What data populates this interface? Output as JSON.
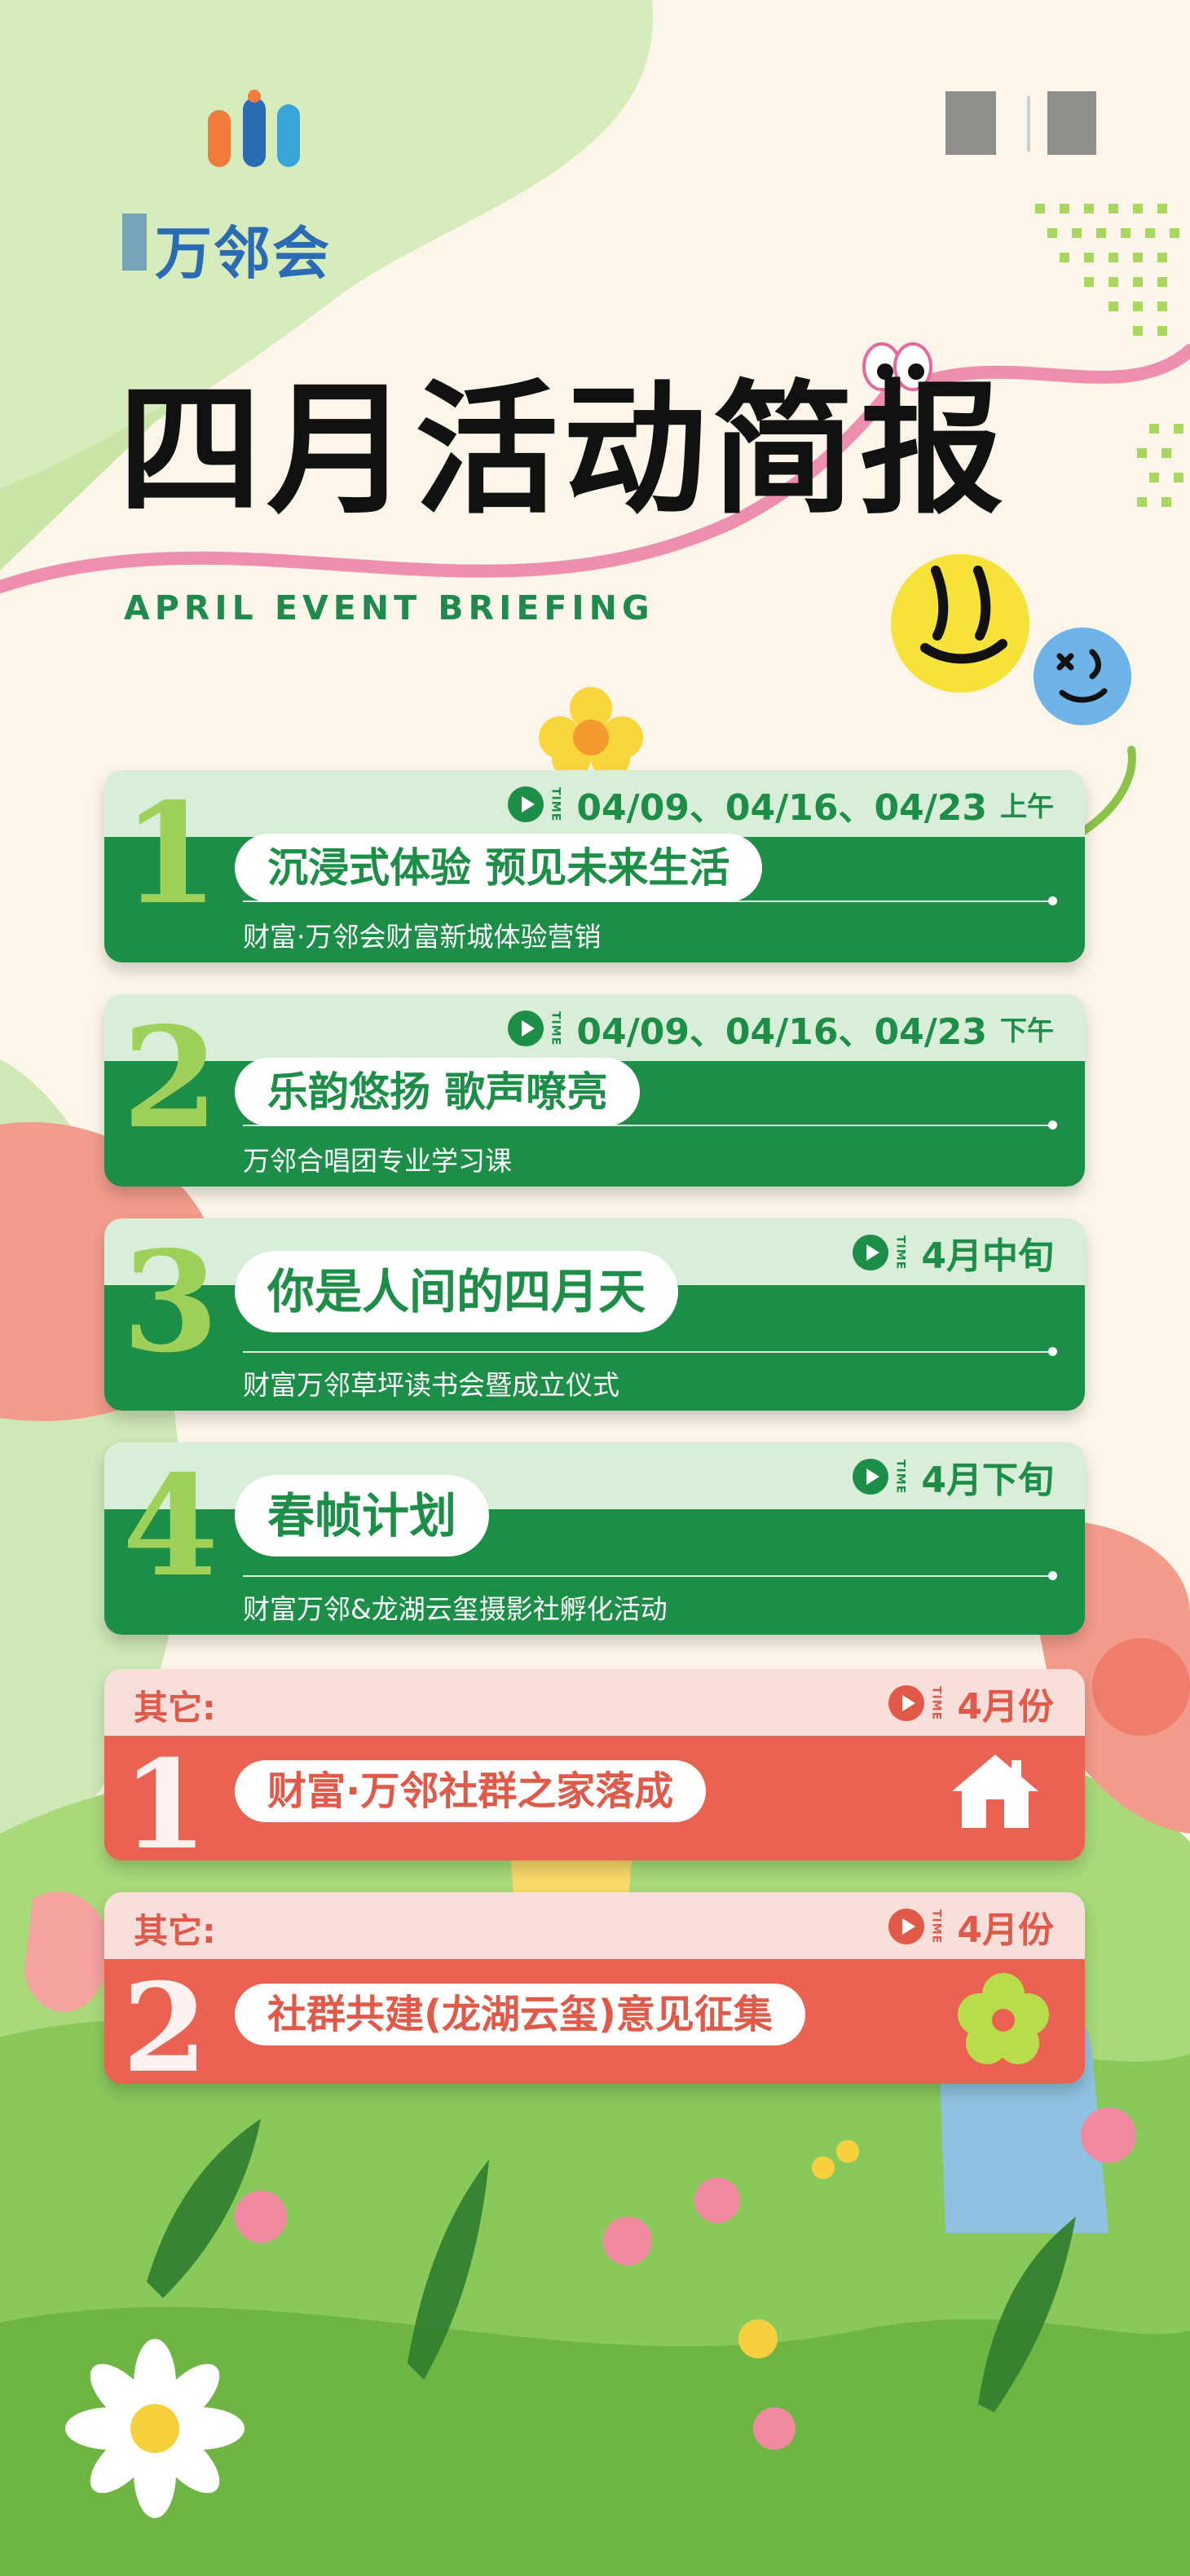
{
  "brand": {
    "logo_text": "万邻会",
    "colors": {
      "green": "#1d8e47",
      "light_green": "#d9eed9",
      "accent_lime": "#9ed05a",
      "red": "#ea6251",
      "light_red": "#f8dfdb",
      "cream": "#fbf6e9"
    }
  },
  "header": {
    "title": "四月活动简报",
    "subtitle": "APRIL EVENT BRIEFING"
  },
  "time_tag": "TIME",
  "events": [
    {
      "number": "1",
      "time": "04/09、04/16、04/23",
      "period": "上午",
      "title": "沉浸式体验 预见未来生活",
      "description": "财富·万邻会财富新城体验营销"
    },
    {
      "number": "2",
      "time": "04/09、04/16、04/23",
      "period": "下午",
      "title": "乐韵悠扬 歌声嘹亮",
      "description": "万邻合唱团专业学习课"
    },
    {
      "number": "3",
      "time": "4月中旬",
      "title": "你是人间的四月天",
      "description": "财富万邻草坪读书会暨成立仪式"
    },
    {
      "number": "4",
      "time": "4月下旬",
      "title": "春帧计划",
      "description": "财富万邻&龙湖云玺摄影社孵化活动"
    }
  ],
  "others": [
    {
      "label": "其它:",
      "number": "1",
      "time": "4月份",
      "title": "财富·万邻社群之家落成",
      "icon": "house-icon"
    },
    {
      "label": "其它:",
      "number": "2",
      "time": "4月份",
      "title": "社群共建(龙湖云玺)意见征集",
      "icon": "flower-icon"
    }
  ]
}
